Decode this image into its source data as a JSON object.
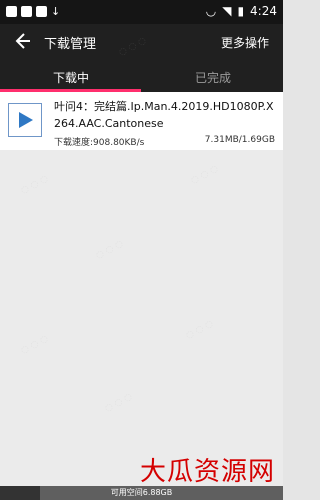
{
  "statusbar": {
    "time": "4:24"
  },
  "appbar": {
    "title": "下载管理",
    "more": "更多操作"
  },
  "tabs": {
    "downloading": "下载中",
    "completed": "已完成"
  },
  "download": {
    "filename": "叶问4：完结篇.Ip.Man.4.2019.HD1080P.X264.AAC.Cantonese",
    "speed": "下载速度:908.80KB/s",
    "size": "7.31MB/1.69GB"
  },
  "footer": {
    "storage": "可用空间6.88GB"
  },
  "overlay": {
    "brand": "大瓜资源网"
  },
  "colors": {
    "accent": "#ff2f6d",
    "appbar": "#202020"
  }
}
